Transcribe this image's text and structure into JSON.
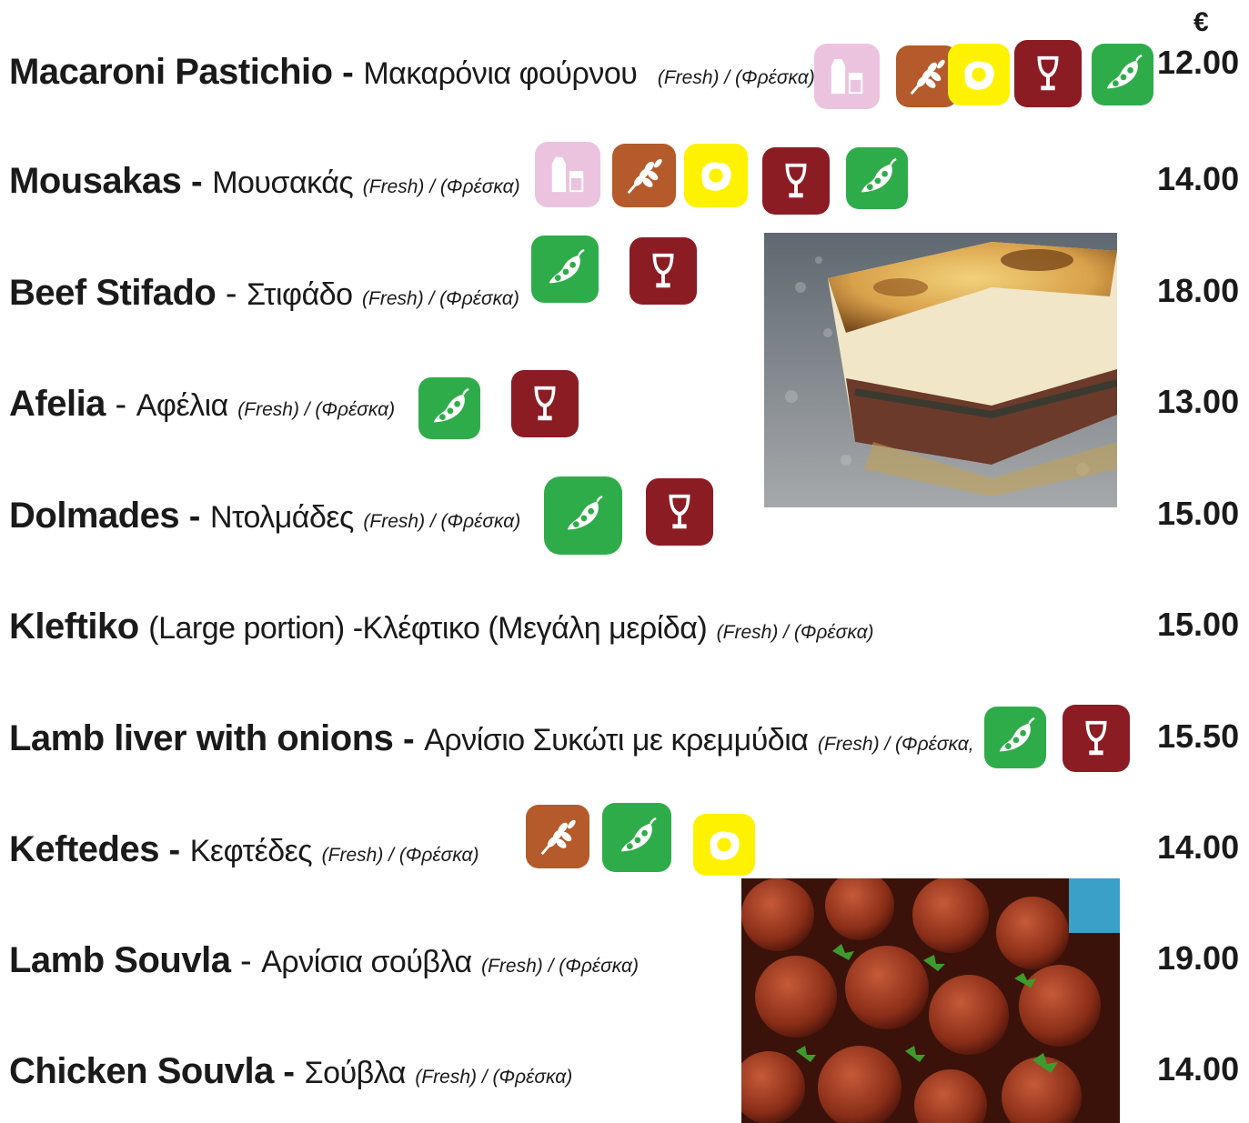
{
  "currency_symbol": "€",
  "fresh_label": "(Fresh) / (Φρέσκα)",
  "fresh_label_cut": "(Fresh) / (Φρέσκα,",
  "colors": {
    "milk": "#ecc3df",
    "gluten": "#b55a2a",
    "egg": "#fff200",
    "wine": "#8c1c24",
    "veg": "#2fac4a"
  },
  "items": [
    {
      "en": "Macaroni Pastichio",
      "sep": " - ",
      "gr": "Μακαρόνια φούρνου",
      "price": "12.00",
      "icons": [
        "milk-icon",
        "gluten-icon",
        "egg-icon",
        "wine-glass-icon",
        "soybean-icon"
      ]
    },
    {
      "en": "Mousakas",
      "sep": " - ",
      "gr": "Μουσακάς",
      "price": "14.00",
      "icons": [
        "milk-icon",
        "gluten-icon",
        "egg-icon",
        "wine-glass-icon",
        "soybean-icon"
      ]
    },
    {
      "en": "Beef Stifado",
      "sep": " - ",
      "gr": "Στιφάδο",
      "price": "18.00",
      "icons": [
        "soybean-icon",
        "wine-glass-icon"
      ]
    },
    {
      "en": "Afelia",
      "sep": " - ",
      "gr": "Αφέλια",
      "price": "13.00",
      "icons": [
        "soybean-icon",
        "wine-glass-icon"
      ]
    },
    {
      "en": "Dolmades",
      "sep": " - ",
      "gr": "Ντολμάδες",
      "price": "15.00",
      "icons": [
        "soybean-icon",
        "wine-glass-icon"
      ]
    },
    {
      "en": "Kleftiko",
      "sep": " ",
      "gr": "(Large portion) -Κλέφτικο (Μεγάλη μερίδα)",
      "price": "15.00",
      "icons": []
    },
    {
      "en": "Lamb liver with onions",
      "sep": " - ",
      "gr": "Αρνίσιο Συκώτι με κρεμμύδια",
      "price": "15.50",
      "icons": [
        "soybean-icon",
        "wine-glass-icon"
      ]
    },
    {
      "en": "Keftedes",
      "sep": " - ",
      "gr": "Κεφτέδες",
      "price": "14.00",
      "icons": [
        "gluten-icon",
        "soybean-icon",
        "egg-icon"
      ]
    },
    {
      "en": "Lamb Souvla",
      "sep": " - ",
      "gr": "Αρνίσια σούβλα",
      "price": "19.00",
      "icons": []
    },
    {
      "en": "Chicken Souvla",
      "sep": " - ",
      "gr": "Σούβλα",
      "price": "14.00",
      "icons": []
    }
  ]
}
